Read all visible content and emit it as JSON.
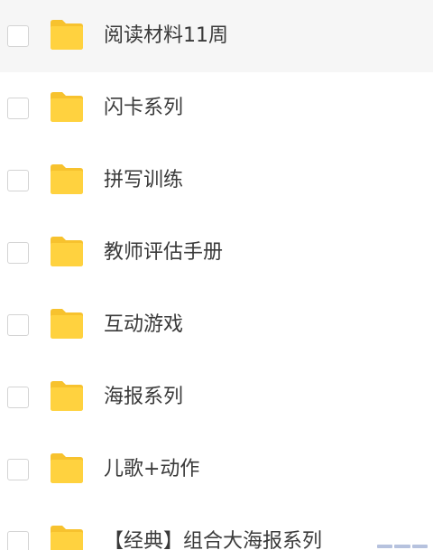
{
  "folders": [
    {
      "name": "阅读材料11周",
      "selected": true
    },
    {
      "name": "闪卡系列"
    },
    {
      "name": "拼写训练"
    },
    {
      "name": "教师评估手册"
    },
    {
      "name": "互动游戏"
    },
    {
      "name": "海报系列"
    },
    {
      "name": "儿歌+动作"
    },
    {
      "name": "【经典】组合大海报系列"
    }
  ],
  "colors": {
    "folder_fill": "#FFD23F",
    "folder_tab": "#F7C22E",
    "selected_row_bg": "#F6F6F6",
    "label_text": "#3A3A3A",
    "checkbox_border": "#D4D4D4"
  },
  "icons": {
    "folder": "folder-icon",
    "checkbox": "checkbox-icon"
  }
}
